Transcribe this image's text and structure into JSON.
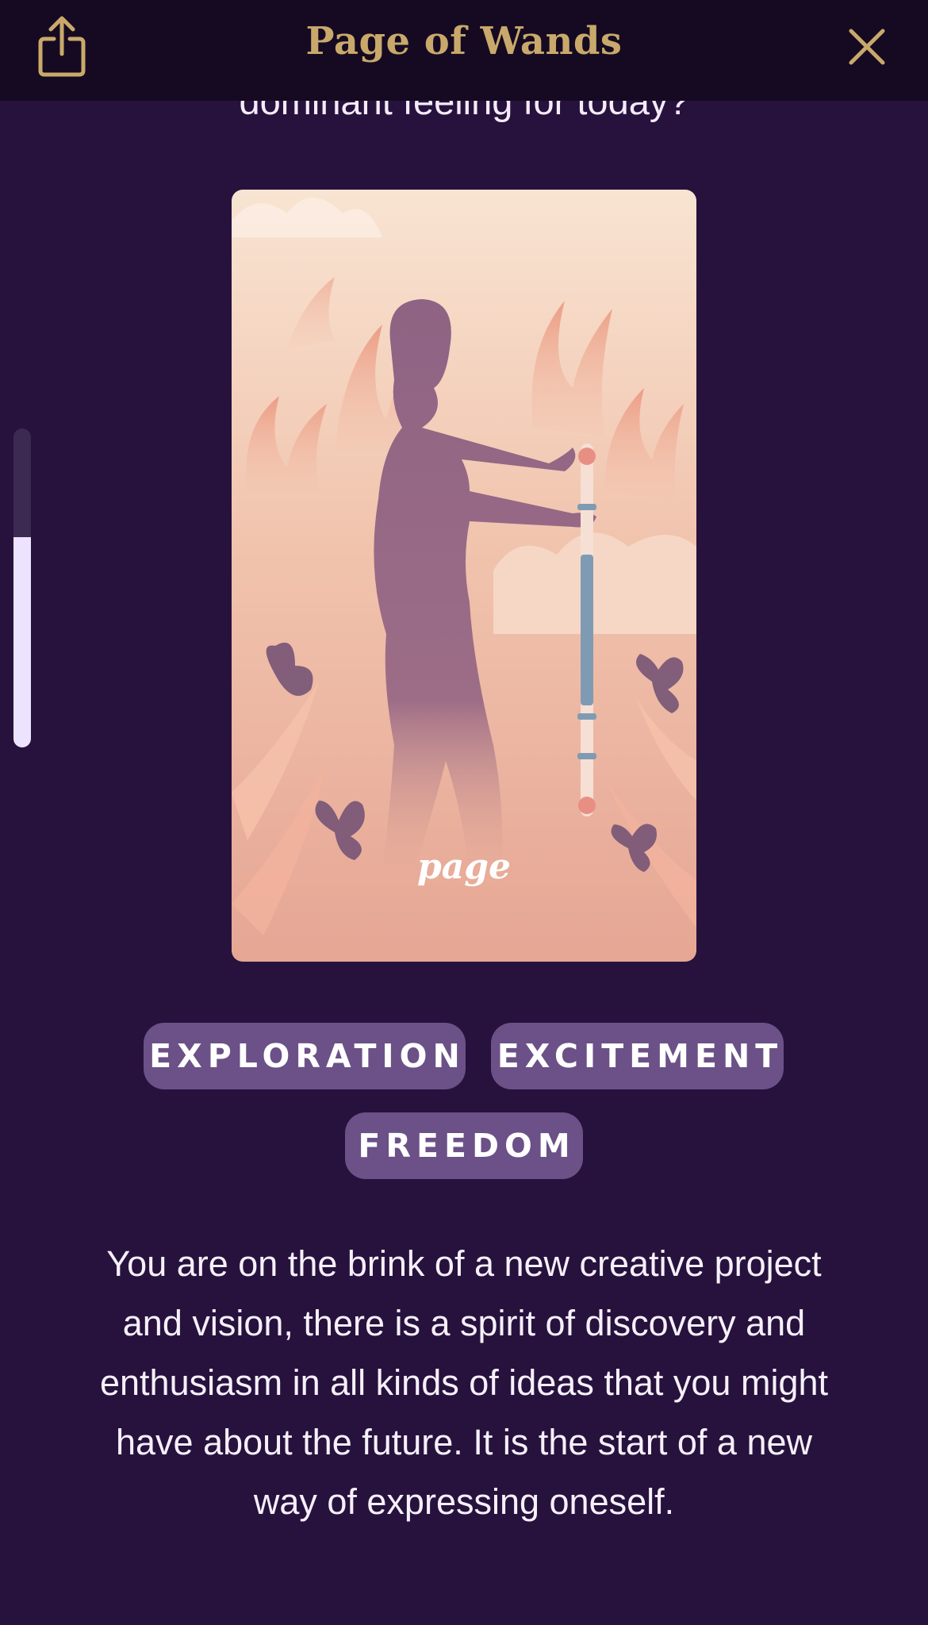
{
  "header": {
    "title": "Page of Wands",
    "share_icon": "share-icon",
    "close_icon": "close-icon",
    "accent_color": "#c9a96b"
  },
  "prompt": {
    "text": "dominant feeling for today?"
  },
  "scroll": {
    "position_fraction": 0.66
  },
  "card": {
    "name": "Page of Wands",
    "label": "page"
  },
  "tags": [
    {
      "label": "EXPLORATION"
    },
    {
      "label": "EXCITEMENT"
    },
    {
      "label": "FREEDOM"
    }
  ],
  "description": "You are on the brink of a new creative project and vision, there is a spirit of discovery and enthusiasm in all kinds of ideas that you might have about the future. It is the start of a new way of expressing oneself.",
  "colors": {
    "background": "#27123d",
    "topbar": "#160a22",
    "tag_background": "#6b5187",
    "scroll_thumb": "#eee3ff"
  }
}
